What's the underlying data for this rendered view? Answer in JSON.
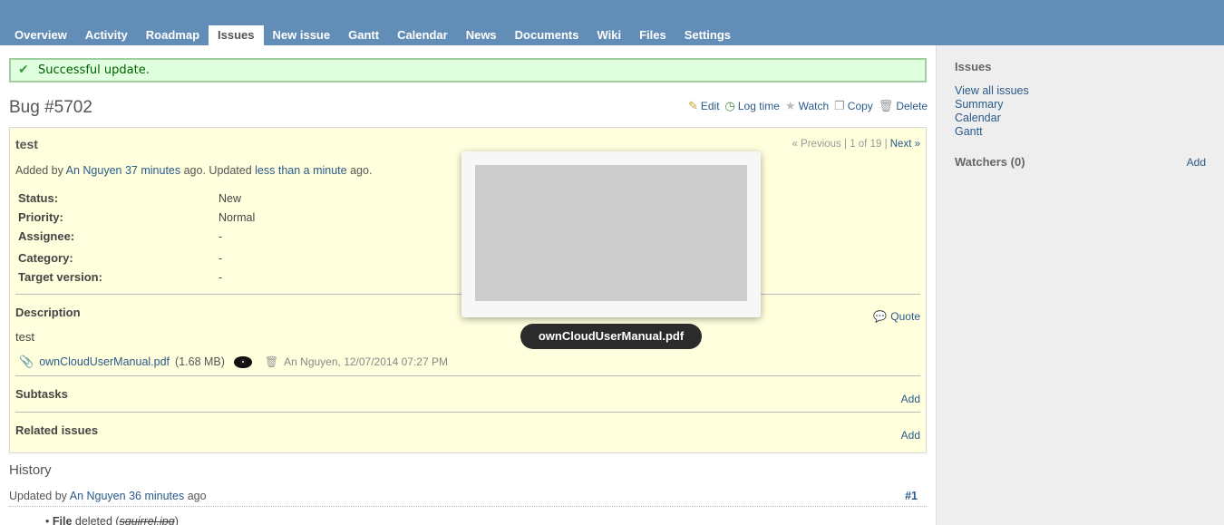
{
  "menu": {
    "tabs": [
      {
        "label": "Overview"
      },
      {
        "label": "Activity"
      },
      {
        "label": "Roadmap"
      },
      {
        "label": "Issues"
      },
      {
        "label": "New issue"
      },
      {
        "label": "Gantt"
      },
      {
        "label": "Calendar"
      },
      {
        "label": "News"
      },
      {
        "label": "Documents"
      },
      {
        "label": "Wiki"
      },
      {
        "label": "Files"
      },
      {
        "label": "Settings"
      }
    ],
    "selected": "Issues"
  },
  "flash": {
    "message": "Successful update."
  },
  "issue": {
    "title": "Bug #5702",
    "actions": {
      "edit": "Edit",
      "log_time": "Log time",
      "watch": "Watch",
      "copy": "Copy",
      "delete": "Delete"
    },
    "subject": "test",
    "pager": {
      "previous": "« Previous",
      "position": "1 of 19",
      "next": "Next »"
    },
    "author": {
      "added_by_prefix": "Added by",
      "author_name": "An Nguyen",
      "added_ago": "37 minutes",
      "updated_prefix": "ago. Updated",
      "updated_ago": "less than a minute",
      "suffix": "ago."
    },
    "attributes": [
      {
        "label": "Status:",
        "value": "New"
      },
      {
        "label": "Priority:",
        "value": "Normal"
      },
      {
        "label": "Assignee:",
        "value": "-"
      },
      {
        "label": "Category:",
        "value": "-"
      },
      {
        "label": "Target version:",
        "value": "-"
      }
    ],
    "description": {
      "title": "Description",
      "quote": "Quote",
      "text": "test"
    },
    "attachment": {
      "filename": "ownCloudUserManual.pdf",
      "size": "(1.68 MB)",
      "author_date": "An Nguyen, 12/07/2014 07:27 PM"
    },
    "subtasks": {
      "title": "Subtasks",
      "add": "Add"
    },
    "relations": {
      "title": "Related issues",
      "add": "Add"
    }
  },
  "history": {
    "title": "History",
    "journal": {
      "prefix": "Updated by",
      "author": "An Nguyen",
      "ago": "36 minutes",
      "suffix": "ago",
      "number": "#1",
      "detail_label": "File",
      "detail_action": "deleted (",
      "detail_value": "squirrel.jpg",
      "detail_close": ")"
    }
  },
  "preview": {
    "tooltip": "ownCloudUserManual.pdf"
  },
  "sidebar": {
    "issues_title": "Issues",
    "links": [
      {
        "label": "View all issues"
      },
      {
        "label": "Summary"
      },
      {
        "label": "Calendar"
      },
      {
        "label": "Gantt"
      }
    ],
    "watchers_title": "Watchers (0)",
    "watchers_add": "Add"
  },
  "colors": {
    "header": "#628db6",
    "link": "#2a5a8a",
    "issue_bg": "#ffffdd",
    "flash_bg": "#dfffdf",
    "sidebar_bg": "#eeeeee"
  }
}
